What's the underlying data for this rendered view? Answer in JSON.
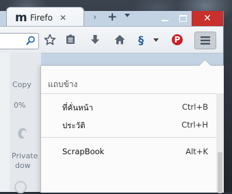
{
  "tab": {
    "favicon_letter": "m",
    "title": "Firefo",
    "close_glyph": "✕"
  },
  "tabstrip": {
    "scroll_glyph": "›",
    "new_tab_glyph": "+"
  },
  "window_controls": {
    "close_glyph": "✕"
  },
  "toolbar": {
    "icons": [
      "search-icon",
      "bookmark-star-icon",
      "reading-list-icon",
      "download-icon",
      "home-icon",
      "scrapbook-icon",
      "dropdown-icon",
      "pinterest-icon",
      "hamburger-menu-icon"
    ],
    "scrapbook_glyph": "§",
    "pinterest_glyph": "P",
    "accent_pinterest": "#cb2027"
  },
  "page": {
    "copy_text": "Copy",
    "percent_text": "0%",
    "private_text": "Private",
    "window_text": "dow"
  },
  "menu": {
    "heading": "แถบข้าง",
    "items": [
      {
        "label": "ที่คั่นหน้า",
        "shortcut": "Ctrl+B"
      },
      {
        "label": "ประวัติ",
        "shortcut": "Ctrl+H"
      },
      {
        "label": "ScrapBook",
        "shortcut": "Alt+K"
      }
    ]
  },
  "colors": {
    "close_button": "#c7302c",
    "frame": "#c3d3e4"
  }
}
